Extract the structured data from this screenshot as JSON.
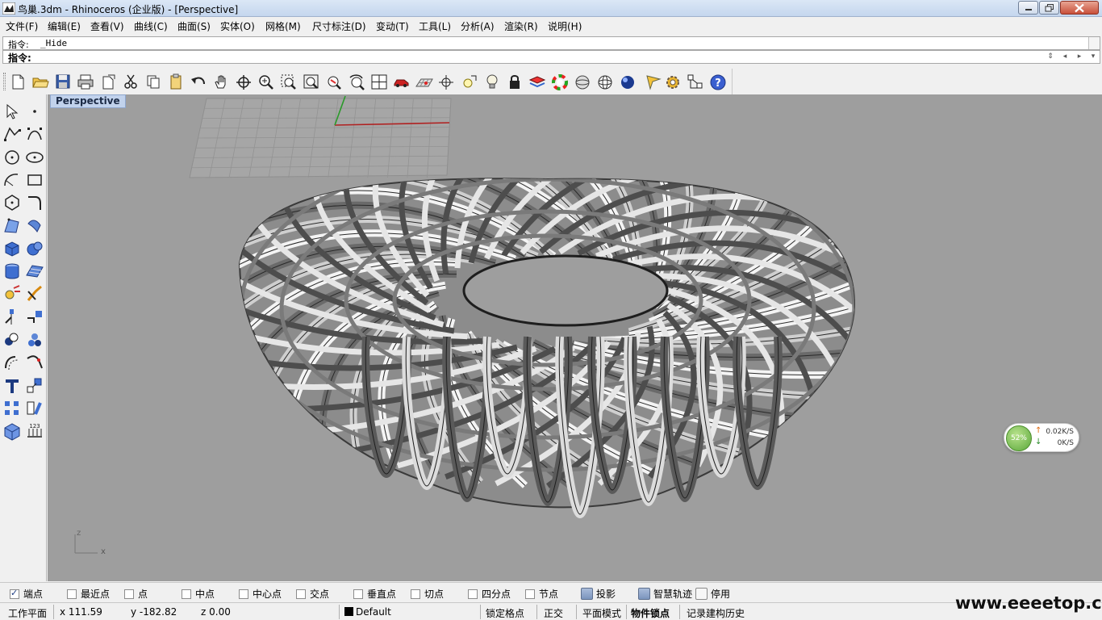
{
  "window": {
    "title": "鸟巢.3dm - Rhinoceros (企业版) - [Perspective]"
  },
  "menu": [
    "文件(F)",
    "编辑(E)",
    "查看(V)",
    "曲线(C)",
    "曲面(S)",
    "实体(O)",
    "网格(M)",
    "尺寸标注(D)",
    "变动(T)",
    "工具(L)",
    "分析(A)",
    "渲染(R)",
    "说明(H)"
  ],
  "command": {
    "history_label": "指令:",
    "history_value": "_Hide",
    "prompt_label": "指令:"
  },
  "toolbar_icons": [
    "new-icon",
    "open-icon",
    "save-icon",
    "print-icon",
    "import-icon",
    "cut-icon",
    "copy-icon",
    "paste-icon",
    "undo-icon",
    "pan-icon",
    "rotate-view-icon",
    "zoom-icon",
    "zoom-window-icon",
    "zoom-extents-icon",
    "zoom-selected-icon",
    "undo-view-icon",
    "four-viewports-icon",
    "car-icon",
    "grid-plane-icon",
    "cplane-icon",
    "point-light-icon",
    "light-bulb-icon",
    "lock-icon",
    "layer-icon",
    "color-wheel-icon",
    "shaded-sphere-icon",
    "wire-sphere-icon",
    "render-sphere-icon",
    "pen-icon",
    "gear-icon",
    "transform-icon",
    "help-icon"
  ],
  "left_tools": [
    "select-icon",
    "point-icon",
    "polyline-icon",
    "curve-points-icon",
    "circle-icon",
    "ellipse-icon",
    "arc-icon",
    "rectangle-icon",
    "polygon-icon",
    "fillet-icon",
    "surface-corner-icon",
    "loft-icon",
    "box-icon",
    "sphere-icon",
    "cylinder-icon",
    "planar-surface-icon",
    "explode-icon",
    "extend-icon",
    "trim-icon",
    "split-icon",
    "group-icon",
    "boolean-icon",
    "offset-icon",
    "blend-icon",
    "text-icon",
    "scale-icon",
    "array-icon",
    "orient-icon",
    "cube-icon",
    "dimension-icon"
  ],
  "viewport": {
    "title": "Perspective",
    "axis_z": "z",
    "axis_x": "x"
  },
  "network": {
    "percent": "52%",
    "upload": "0.02K/S",
    "download": "0K/S"
  },
  "osnaps": [
    {
      "label": "端点",
      "checked": true
    },
    {
      "label": "最近点",
      "checked": false
    },
    {
      "label": "点",
      "checked": false
    },
    {
      "label": "中点",
      "checked": false
    },
    {
      "label": "中心点",
      "checked": false
    },
    {
      "label": "交点",
      "checked": false
    },
    {
      "label": "垂直点",
      "checked": false
    },
    {
      "label": "切点",
      "checked": false
    },
    {
      "label": "四分点",
      "checked": false
    },
    {
      "label": "节点",
      "checked": false
    }
  ],
  "toggles": [
    {
      "label": "投影",
      "on": true
    },
    {
      "label": "智慧轨迹",
      "on": true
    },
    {
      "label": "停用",
      "on": false
    }
  ],
  "status": {
    "cplane": "工作平面",
    "x": "x 111.59",
    "y": "y -182.82",
    "z": "z 0.00",
    "layer": "Default",
    "layer_color": "#000000",
    "snap": "锁定格点",
    "ortho": "正交",
    "planar": "平面模式",
    "osnap": "物件锁点",
    "history": "记录建构历史"
  },
  "watermark": "www.eeeetop.com"
}
